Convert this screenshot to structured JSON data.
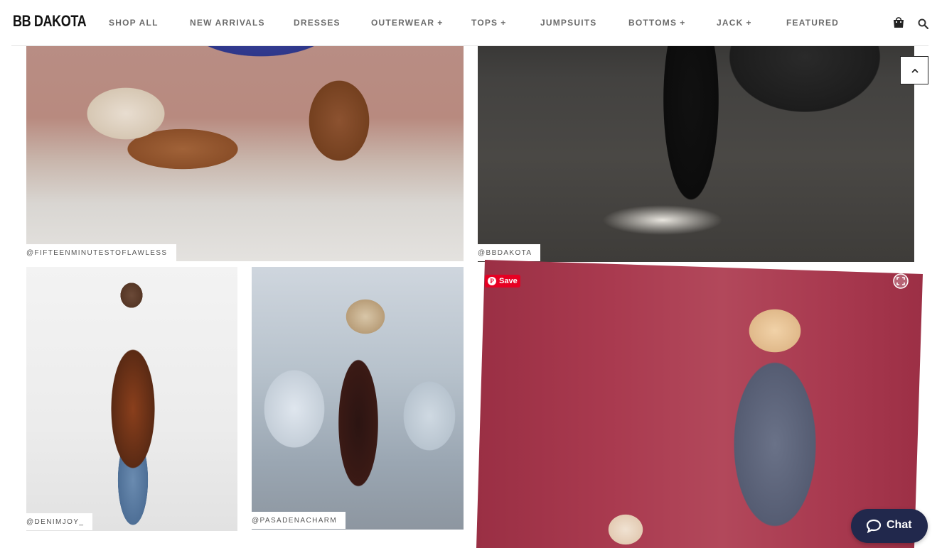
{
  "brand": {
    "logo_text": "BB DAKOTA"
  },
  "nav": {
    "items": [
      {
        "label": "SHOP ALL",
        "plus": ""
      },
      {
        "label": "NEW ARRIVALS",
        "plus": ""
      },
      {
        "label": "DRESSES",
        "plus": ""
      },
      {
        "label": "OUTERWEAR",
        "plus": "+"
      },
      {
        "label": "TOPS",
        "plus": "+"
      },
      {
        "label": "JUMPSUITS",
        "plus": ""
      },
      {
        "label": "BOTTOMS",
        "plus": "+"
      },
      {
        "label": "JACK",
        "plus": "+"
      },
      {
        "label": "FEATURED",
        "plus": ""
      }
    ]
  },
  "icons": {
    "cart": "shopping-bag-icon",
    "search": "search-icon",
    "back_to_top": "chevron-up-icon",
    "expand": "expand-icon",
    "chat": "chat-bubble-icon"
  },
  "gallery": {
    "tiles": [
      {
        "credit": "@FIFTEENMINUTESTOFLAWLESS"
      },
      {
        "credit": "@BBDAKOTA"
      },
      {
        "credit": "@DENIMJOY_"
      },
      {
        "credit": "@PASADENACHARM"
      },
      {
        "credit": ""
      }
    ]
  },
  "pinterest": {
    "save_label": "Save",
    "color": "#e60023"
  },
  "chat": {
    "label": "Chat",
    "color": "#21284c"
  }
}
